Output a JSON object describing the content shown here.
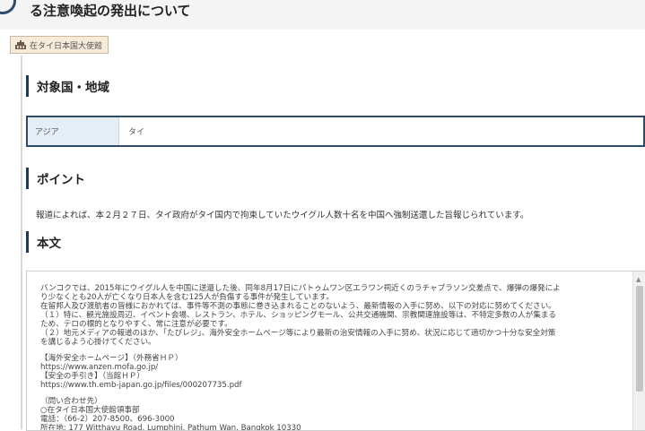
{
  "header": {
    "title": "る注意喚起の発出について"
  },
  "embassy": {
    "label": "在タイ日本国大使館"
  },
  "sections": {
    "target": {
      "heading": "対象国・地域",
      "region_key": "アジア",
      "region_value": "タイ"
    },
    "point": {
      "heading": "ポイント",
      "text": "報道によれば、本２月２７日、タイ政府がタイ国内で拘束していたウイグル人数十名を中国へ強制送還した旨報じられています。"
    },
    "body": {
      "heading": "本文",
      "lines": [
        "バンコクでは、2015年にウイグル人を中国に送還した後、同年8月17日にパトゥムワン区エラワン祠近くのラチャプラソン交差点で、爆弾の爆発によ",
        "り少なくとも20人が亡くなり日本人を含む125人が負傷する事件が発生しています。",
        "在留邦人及び渡航者の皆様におかれては、事件等不測の事態に巻き込まれることのないよう、最新情報の入手に努め、以下の対応に努めてください。",
        "（１）特に、観光施設周辺、イベント会場、レストラン、ホテル、ショッピングモール、公共交通機関、宗教関連施設等は、不特定多数の人が集まる",
        "ため、テロの標的となりやすく、常に注意が必要です。",
        "（２）地元メディアの報道のほか、「たびレジ」、海外安全ホームページ等により最新の治安情報の入手に努め、状況に応じて適切かつ十分な安全対策",
        "を講じるよう心掛けてください。",
        "",
        "【海外安全ホームページ】（外務省ＨＰ）",
        "https://www.anzen.mofa.go.jp/",
        "【安全の手引き】（当館ＨＰ）",
        "https://www.th.emb-japan.go.jp/files/000207735.pdf",
        "",
        "（問い合わせ先）",
        "○在タイ日本国大使館領事部",
        "電話：（66-2）207-8500、696-3000",
        "所在地: 177 Witthayu Road, Lumphini, Pathum Wan, Bangkok 10330"
      ]
    }
  }
}
